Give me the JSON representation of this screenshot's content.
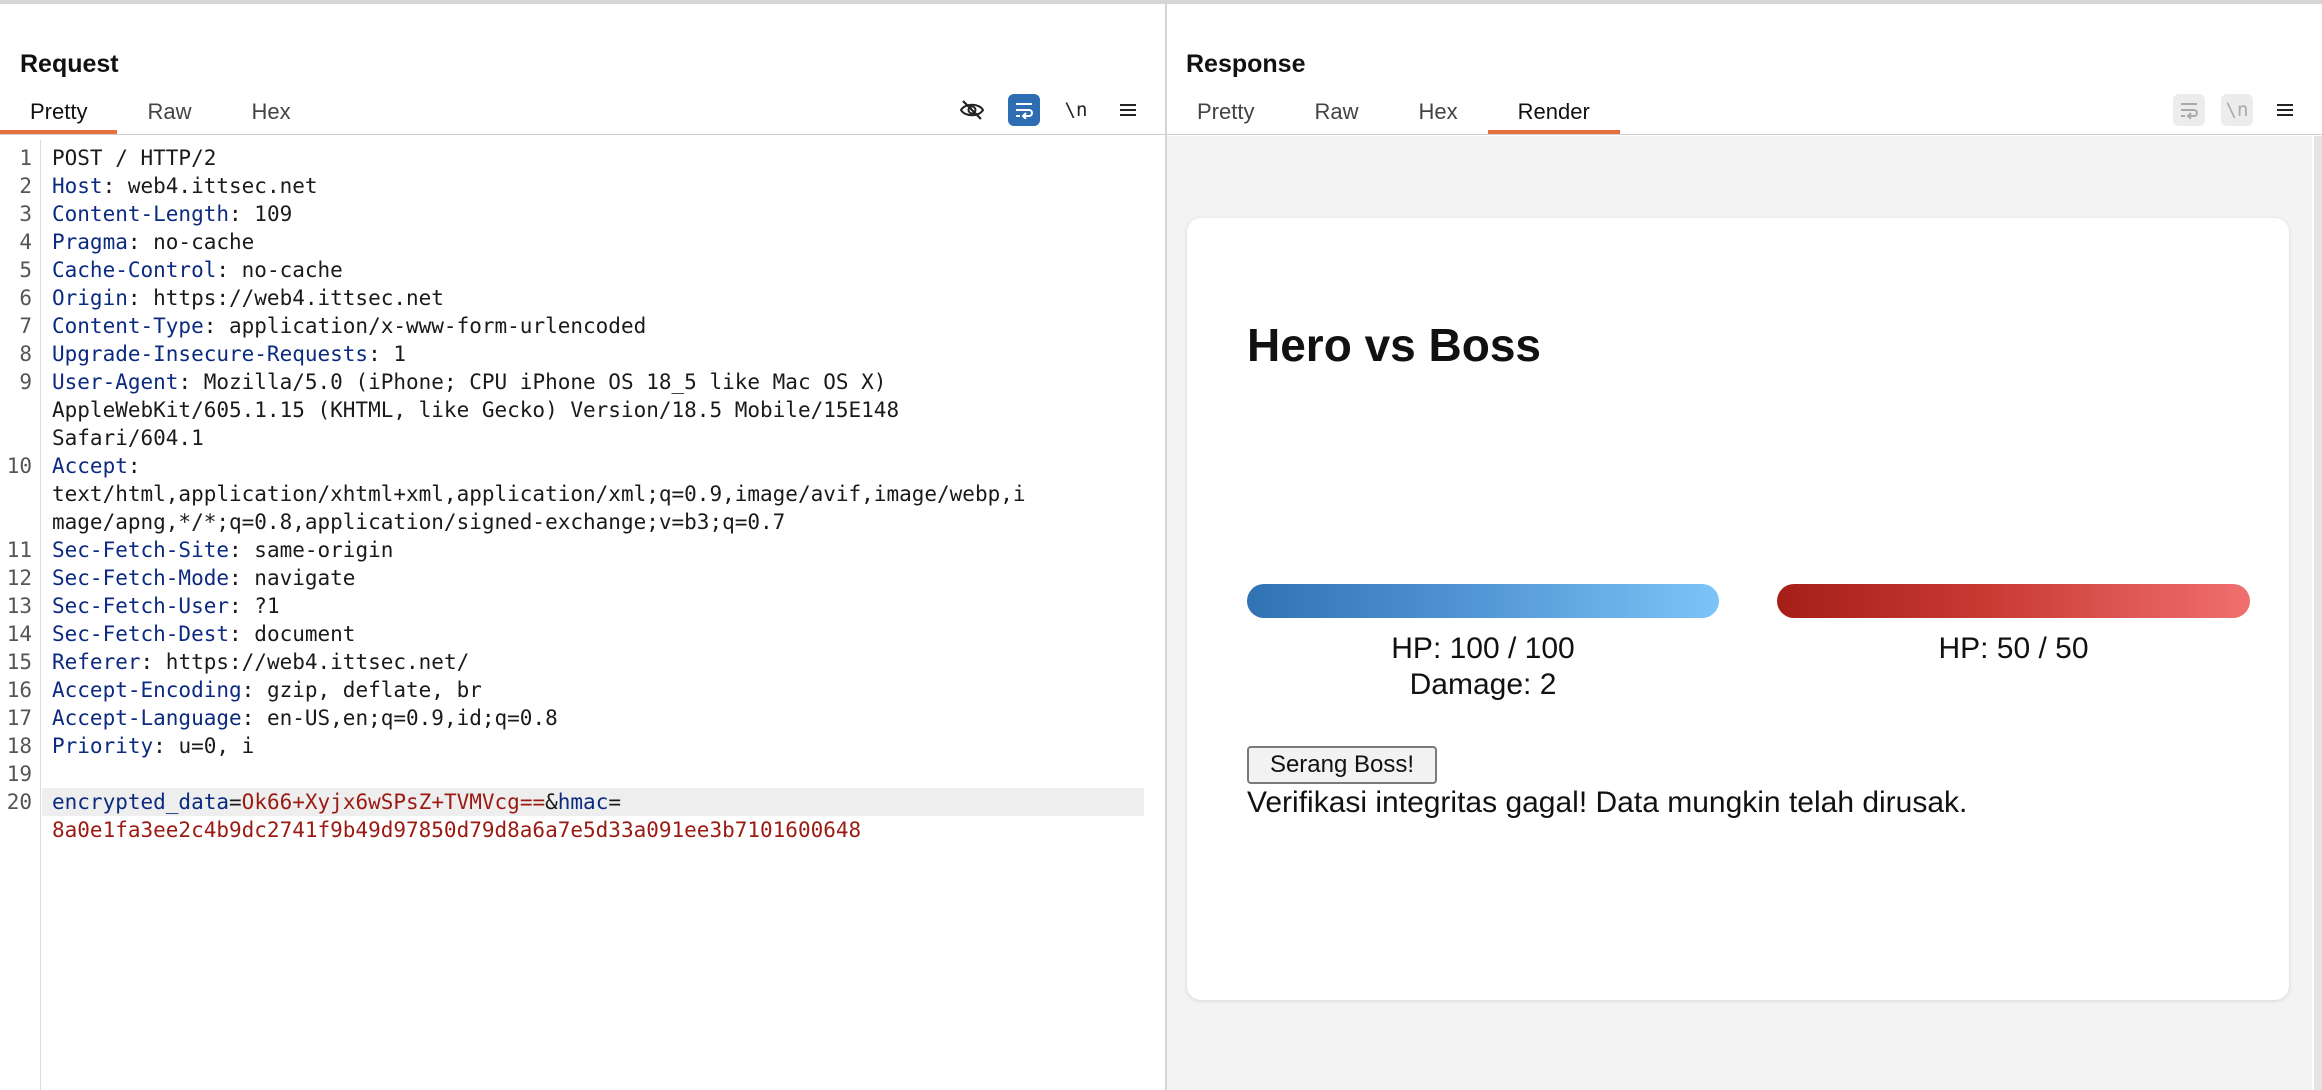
{
  "request": {
    "title": "Request",
    "tabs": [
      "Pretty",
      "Raw",
      "Hex"
    ],
    "active_tab": "Pretty",
    "tools": {
      "hide_icon": "eye-slash-icon",
      "wrap_icon": "word-wrap-icon",
      "newline_label": "\\n",
      "menu_icon": "hamburger-menu-icon"
    },
    "lines": [
      {
        "n": "1",
        "parts": [
          [
            "hv",
            "POST / HTTP/2"
          ]
        ]
      },
      {
        "n": "2",
        "parts": [
          [
            "hk",
            "Host"
          ],
          [
            "hv",
            ": web4.ittsec.net"
          ]
        ]
      },
      {
        "n": "3",
        "parts": [
          [
            "hk",
            "Content-Length"
          ],
          [
            "hv",
            ": 109"
          ]
        ]
      },
      {
        "n": "4",
        "parts": [
          [
            "hk",
            "Pragma"
          ],
          [
            "hv",
            ": no-cache"
          ]
        ]
      },
      {
        "n": "5",
        "parts": [
          [
            "hk",
            "Cache-Control"
          ],
          [
            "hv",
            ": no-cache"
          ]
        ]
      },
      {
        "n": "6",
        "parts": [
          [
            "hk",
            "Origin"
          ],
          [
            "hv",
            ": https://web4.ittsec.net"
          ]
        ]
      },
      {
        "n": "7",
        "parts": [
          [
            "hk",
            "Content-Type"
          ],
          [
            "hv",
            ": application/x-www-form-urlencoded"
          ]
        ]
      },
      {
        "n": "8",
        "parts": [
          [
            "hk",
            "Upgrade-Insecure-Requests"
          ],
          [
            "hv",
            ": 1"
          ]
        ]
      },
      {
        "n": "9",
        "parts": [
          [
            "hk",
            "User-Agent"
          ],
          [
            "hv",
            ": Mozilla/5.0 (iPhone; CPU iPhone OS 18_5 like Mac OS X)"
          ]
        ]
      },
      {
        "n": "",
        "parts": [
          [
            "hv",
            "AppleWebKit/605.1.15 (KHTML, like Gecko) Version/18.5 Mobile/15E148"
          ]
        ]
      },
      {
        "n": "",
        "parts": [
          [
            "hv",
            "Safari/604.1"
          ]
        ]
      },
      {
        "n": "10",
        "parts": [
          [
            "hk",
            "Accept"
          ],
          [
            "hv",
            ":"
          ]
        ]
      },
      {
        "n": "",
        "parts": [
          [
            "hv",
            "text/html,application/xhtml+xml,application/xml;q=0.9,image/avif,image/webp,i"
          ]
        ]
      },
      {
        "n": "",
        "parts": [
          [
            "hv",
            "mage/apng,*/*;q=0.8,application/signed-exchange;v=b3;q=0.7"
          ]
        ]
      },
      {
        "n": "11",
        "parts": [
          [
            "hk",
            "Sec-Fetch-Site"
          ],
          [
            "hv",
            ": same-origin"
          ]
        ]
      },
      {
        "n": "12",
        "parts": [
          [
            "hk",
            "Sec-Fetch-Mode"
          ],
          [
            "hv",
            ": navigate"
          ]
        ]
      },
      {
        "n": "13",
        "parts": [
          [
            "hk",
            "Sec-Fetch-User"
          ],
          [
            "hv",
            ": ?1"
          ]
        ]
      },
      {
        "n": "14",
        "parts": [
          [
            "hk",
            "Sec-Fetch-Dest"
          ],
          [
            "hv",
            ": document"
          ]
        ]
      },
      {
        "n": "15",
        "parts": [
          [
            "hk",
            "Referer"
          ],
          [
            "hv",
            ": https://web4.ittsec.net/"
          ]
        ]
      },
      {
        "n": "16",
        "parts": [
          [
            "hk",
            "Accept-Encoding"
          ],
          [
            "hv",
            ": gzip, deflate, br"
          ]
        ]
      },
      {
        "n": "17",
        "parts": [
          [
            "hk",
            "Accept-Language"
          ],
          [
            "hv",
            ": en-US,en;q=0.9,id;q=0.8"
          ]
        ]
      },
      {
        "n": "18",
        "parts": [
          [
            "hk",
            "Priority"
          ],
          [
            "hv",
            ": u=0, i"
          ]
        ]
      },
      {
        "n": "19",
        "parts": []
      },
      {
        "n": "20",
        "highlight": true,
        "parts": [
          [
            "pk",
            "encrypted_data"
          ],
          [
            "po",
            "="
          ],
          [
            "pv",
            "Ok66+Xyjx6wSPsZ+TVMVcg=="
          ],
          [
            "po",
            "&"
          ],
          [
            "pk",
            "hmac"
          ],
          [
            "po",
            "="
          ]
        ]
      },
      {
        "n": "",
        "parts": [
          [
            "pv",
            "8a0e1fa3ee2c4b9dc2741f9b49d97850d79d8a6a7e5d33a091ee3b7101600648"
          ]
        ]
      }
    ]
  },
  "response": {
    "title": "Response",
    "tabs": [
      "Pretty",
      "Raw",
      "Hex",
      "Render"
    ],
    "active_tab": "Render",
    "tools": {
      "wrap_icon": "word-wrap-icon",
      "newline_label": "\\n",
      "menu_icon": "hamburger-menu-icon"
    },
    "render": {
      "title": "Hero vs Boss",
      "hero": {
        "hp_text": "HP: 100 / 100",
        "damage_text": "Damage: 2",
        "hp_fraction": 1.0
      },
      "boss": {
        "hp_text": "HP: 50 / 50",
        "hp_fraction": 1.0
      },
      "attack_button": "Serang Boss!",
      "message": "Verifikasi integritas gagal! Data mungkin telah dirusak."
    }
  },
  "layout_switch": {
    "options": [
      "side-by-side-icon",
      "stacked-icon",
      "single-pane-icon"
    ],
    "selected": "side-by-side-icon"
  },
  "colors": {
    "accent": "#e8703a",
    "header_key": "#0b2a80",
    "param_value": "#9a1a12",
    "toggle_on": "#2e6db4"
  }
}
